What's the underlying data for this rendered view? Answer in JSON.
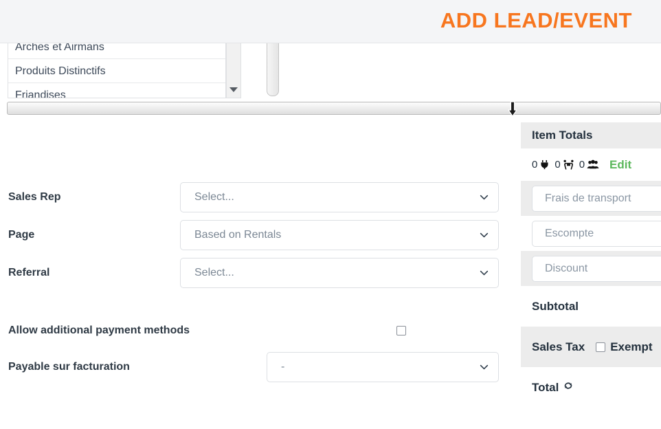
{
  "header": {
    "title": "ADD LEAD/EVENT"
  },
  "category_listbox": {
    "name": "category-listbox",
    "options": [
      {
        "label": "Arches et Airmans"
      },
      {
        "label": "Produits Distinctifs"
      },
      {
        "label": "Friandises"
      }
    ],
    "scroll_down_icon": "chevron-down-icon"
  },
  "form": {
    "rows": [
      {
        "label": "Sales Rep",
        "control": "select",
        "value": "Select...",
        "name": "sales-rep-select"
      },
      {
        "label": "Page",
        "control": "select",
        "value": "Based on Rentals",
        "name": "page-select"
      },
      {
        "label": "Referral",
        "control": "select",
        "value": "Select...",
        "name": "referral-select"
      },
      {
        "label": "Allow additional payment methods",
        "control": "checkbox",
        "checked": false,
        "name": "allow-additional-payment-methods-checkbox"
      },
      {
        "label": "Payable sur facturation",
        "control": "select",
        "value": "-",
        "name": "payable-sur-facturation-select"
      }
    ]
  },
  "item_totals": {
    "header": "Item Totals",
    "counters": [
      {
        "count": "0",
        "icon": "plug-icon"
      },
      {
        "count": "0",
        "icon": "people-carry-icon"
      },
      {
        "count": "0",
        "icon": "users-icon"
      }
    ],
    "edit_label": "Edit",
    "inputs": [
      {
        "placeholder": "Frais de transport",
        "value": "",
        "name": "shipping-fee-input"
      },
      {
        "placeholder": "Escompte",
        "value": "",
        "name": "escompte-input"
      },
      {
        "placeholder": "Discount",
        "value": "",
        "name": "discount-input"
      }
    ],
    "subtotal_label": "Subtotal",
    "sales_tax_label": "Sales Tax",
    "exempt_label": "Exempt",
    "total_label": "Total"
  },
  "colors": {
    "accent_orange": "#f7761f",
    "edit_green": "#5cb85c",
    "header_bg": "#f4f5f7",
    "row_shaded": "#ececec"
  }
}
